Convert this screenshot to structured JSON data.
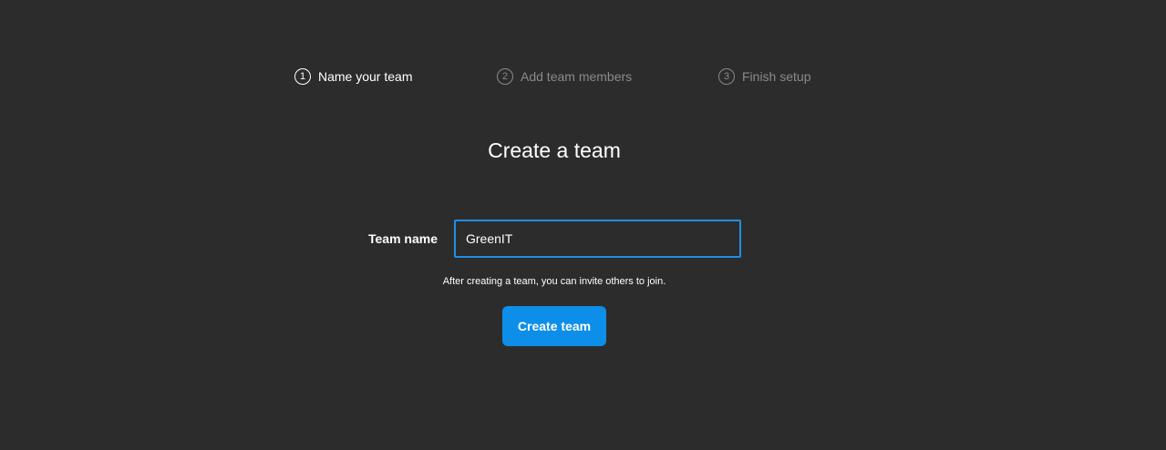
{
  "stepper": {
    "steps": [
      {
        "number": "1",
        "label": "Name your team",
        "state": "active"
      },
      {
        "number": "2",
        "label": "Add team members",
        "state": "inactive"
      },
      {
        "number": "3",
        "label": "Finish setup",
        "state": "inactive"
      }
    ]
  },
  "main": {
    "title": "Create a team",
    "team_name_label": "Team name",
    "team_name_value": "GreenIT",
    "help_text": "After creating a team, you can invite others to join.",
    "create_button_label": "Create team"
  },
  "colors": {
    "background": "#2c2c2c",
    "accent": "#0d8ee9",
    "input_focus_border": "#1d8fe6",
    "inactive_text": "#8a8a8a"
  }
}
